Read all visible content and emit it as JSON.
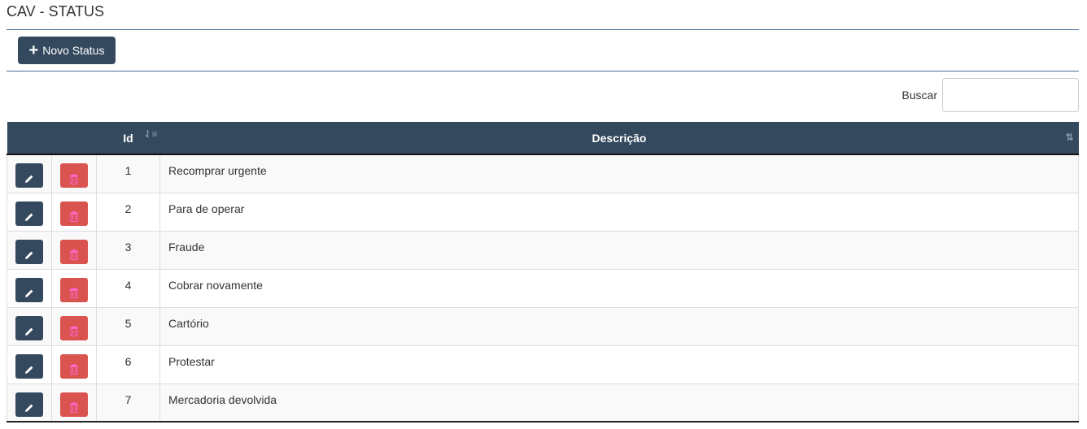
{
  "page": {
    "title": "CAV - STATUS"
  },
  "toolbar": {
    "new_button_label": "Novo Status",
    "new_button_icon": "plus-icon"
  },
  "search": {
    "label": "Buscar",
    "value": "",
    "placeholder": ""
  },
  "table": {
    "columns": [
      {
        "label": ""
      },
      {
        "label": ""
      },
      {
        "label": "Id",
        "sort_icon": "sort-amount-asc-icon"
      },
      {
        "label": "Descrição",
        "sort_icon": "sort-icon"
      }
    ],
    "row_actions": {
      "edit_icon": "pencil-icon",
      "delete_icon": "trash-icon"
    },
    "rows": [
      {
        "id": "1",
        "descricao": "Recomprar urgente"
      },
      {
        "id": "2",
        "descricao": "Para de operar"
      },
      {
        "id": "3",
        "descricao": "Fraude"
      },
      {
        "id": "4",
        "descricao": "Cobrar novamente"
      },
      {
        "id": "5",
        "descricao": "Cartório"
      },
      {
        "id": "6",
        "descricao": "Protestar"
      },
      {
        "id": "7",
        "descricao": "Mercadoria devolvida"
      }
    ]
  },
  "colors": {
    "primary": "#34495e",
    "danger": "#d9534f",
    "rule": "#4a6a96"
  }
}
